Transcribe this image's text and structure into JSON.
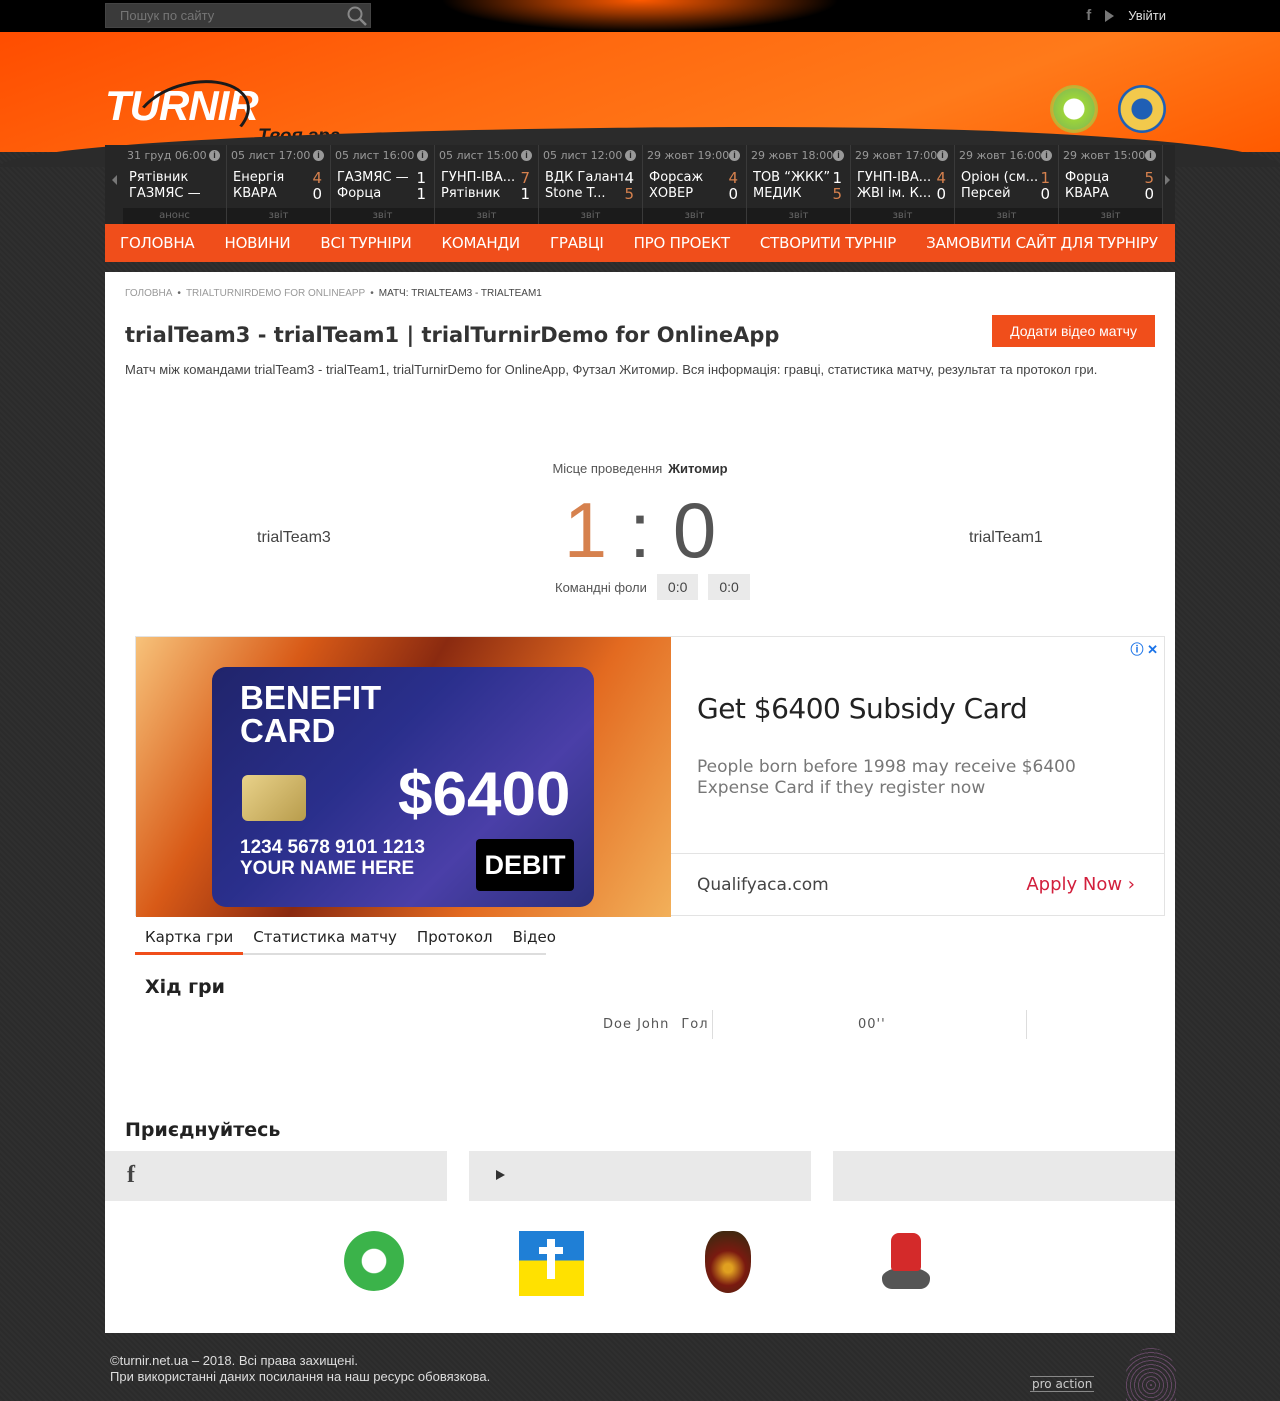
{
  "topbar": {
    "search_placeholder": "Пошук по сайту",
    "login_label": "Увійти",
    "icons": [
      "facebook-icon",
      "youtube-icon"
    ]
  },
  "header": {
    "logo_text": "TURNIR",
    "slogan": "Твоя гра"
  },
  "scoreboard": [
    {
      "date": "31 груд 06:00",
      "home": "Рятівник",
      "home_score": "",
      "away": "ГАЗМЯС —",
      "away_score": "",
      "footer": "анонс"
    },
    {
      "date": "05 лист 17:00",
      "home": "Енергія",
      "home_score": "4",
      "away": "КВАРА",
      "away_score": "0",
      "footer": "звіт"
    },
    {
      "date": "05 лист 16:00",
      "home": "ГАЗМЯС —",
      "home_score": "1",
      "away": "Форца",
      "away_score": "1",
      "footer": "звіт"
    },
    {
      "date": "05 лист 15:00",
      "home": "ГУНП-ІВА...",
      "home_score": "7",
      "away": "Рятівник",
      "away_score": "1",
      "footer": "звіт"
    },
    {
      "date": "05 лист 12:00",
      "home": "ВДК Галант",
      "home_score": "4",
      "away": "Stone T...",
      "away_score": "5",
      "footer": "звіт"
    },
    {
      "date": "29 жовт 19:00",
      "home": "Форсаж",
      "home_score": "4",
      "away": "ХОВЕР",
      "away_score": "0",
      "footer": "звіт"
    },
    {
      "date": "29 жовт 18:00",
      "home": "ТОВ “ЖКК”",
      "home_score": "1",
      "away": "МЕДИК",
      "away_score": "5",
      "footer": "звіт"
    },
    {
      "date": "29 жовт 17:00",
      "home": "ГУНП-ІВА...",
      "home_score": "4",
      "away": "ЖВІ ім. К...",
      "away_score": "0",
      "footer": "звіт"
    },
    {
      "date": "29 жовт 16:00",
      "home": "Оріон (см...",
      "home_score": "1",
      "away": "Персей",
      "away_score": "0",
      "footer": "звіт"
    },
    {
      "date": "29 жовт 15:00",
      "home": "Форца",
      "home_score": "5",
      "away": "КВАРА",
      "away_score": "0",
      "footer": "звіт"
    }
  ],
  "nav": [
    "Головна",
    "Новини",
    "Всі турніри",
    "Команди",
    "Гравці",
    "Про проект",
    "Створити турнір",
    "Замовити сайт для турніру"
  ],
  "breadcrumbs": [
    "Головна",
    "trialTurnirDemo for OnlineApp",
    "Матч: trialTeam3 - trialTeam1"
  ],
  "match": {
    "title": "trialTeam3 - trialTeam1 | trialTurnirDemo for OnlineApp",
    "add_video_label": "Додати відео матчу",
    "description": "Матч між командами trialTeam3 - trialTeam1, trialTurnirDemo for OnlineApp, Футзал Житомир. Вся інформація: гравці, статистика матчу, результат та протокол гри.",
    "venue_label": "Місце проведення",
    "venue": "Житомир",
    "home_team": "trialTeam3",
    "away_team": "trialTeam1",
    "home_score": "1",
    "away_score": "0",
    "score_separator": ":",
    "fouls_label": "Командні фоли",
    "home_fouls": "0:0",
    "away_fouls": "0:0"
  },
  "ad": {
    "card_title_1": "BENEFIT",
    "card_title_2": "CARD",
    "card_amount": "$6400",
    "card_number": "1234 5678 9101 1213",
    "card_name": "YOUR NAME HERE",
    "card_type": "DEBIT",
    "headline": "Get $6400 Subsidy Card",
    "body": "People born before 1998 may receive $6400 Expense Card if they register now",
    "site": "Qualifyaca.com",
    "cta": "Apply Now"
  },
  "tabs": [
    "Картка гри",
    "Статистика матчу",
    "Протокол",
    "Відео"
  ],
  "game": {
    "heading": "Хід гри",
    "events": [
      {
        "player": "Doe John",
        "type": "Гол",
        "minute": "00''"
      }
    ]
  },
  "join": {
    "heading": "Приєднуйтесь"
  },
  "footer": {
    "line1": "©turnir.net.ua – 2018. Всі права захищені.",
    "line2": "При використанні даних посилання на наш ресурс обовязкова.",
    "brand": "pro action"
  },
  "colors": {
    "accent": "#f04e1b",
    "win_score": "#d6814e"
  }
}
